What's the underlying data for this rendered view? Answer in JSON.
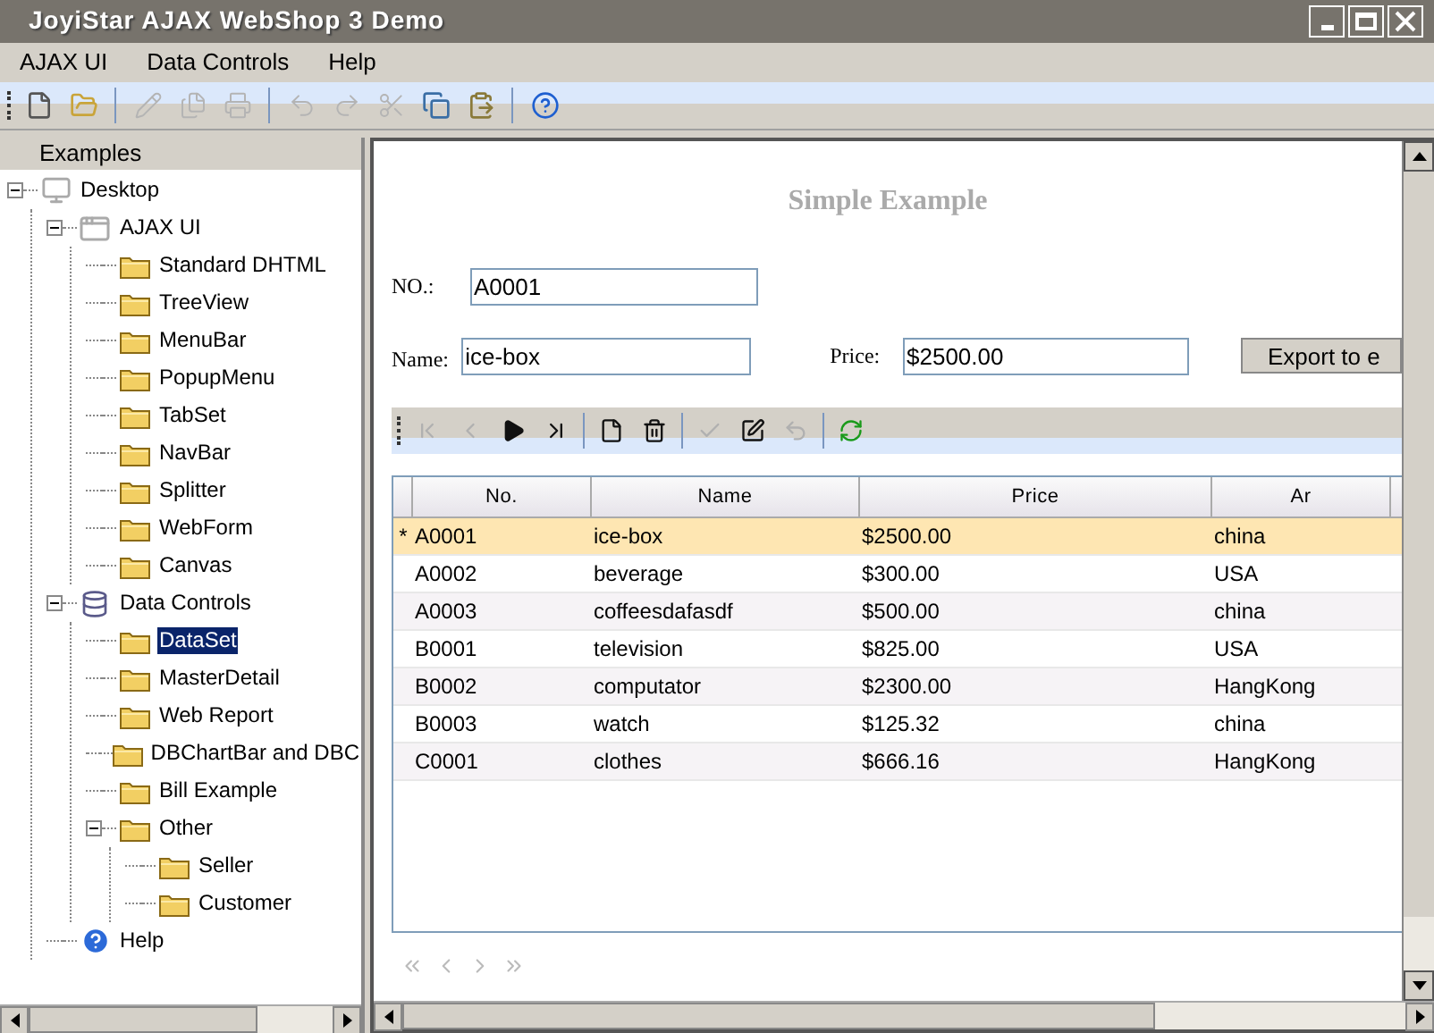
{
  "window": {
    "title": "JoyiStar AJAX WebShop 3 Demo"
  },
  "menu": [
    "AJAX UI",
    "Data Controls",
    "Help"
  ],
  "toolbar": [
    {
      "kind": "new",
      "disabled": false
    },
    {
      "kind": "open",
      "disabled": false
    },
    {
      "kind": "sep"
    },
    {
      "kind": "edit",
      "disabled": true
    },
    {
      "kind": "copy-doc",
      "disabled": true
    },
    {
      "kind": "print",
      "disabled": true
    },
    {
      "kind": "sep"
    },
    {
      "kind": "undo",
      "disabled": true
    },
    {
      "kind": "redo",
      "disabled": true
    },
    {
      "kind": "cut",
      "disabled": true
    },
    {
      "kind": "copy",
      "disabled": false
    },
    {
      "kind": "paste",
      "disabled": false
    },
    {
      "kind": "sep"
    },
    {
      "kind": "help",
      "disabled": false
    }
  ],
  "sidebar": {
    "title": "Examples",
    "tree": [
      {
        "label": "Desktop",
        "kind": "desktop",
        "expanded": true,
        "selected": false,
        "children": [
          {
            "label": "AJAX UI",
            "kind": "window",
            "expanded": true,
            "selected": false,
            "children": [
              {
                "label": "Standard DHTML",
                "kind": "folder",
                "selected": false
              },
              {
                "label": "TreeView",
                "kind": "folder",
                "selected": false
              },
              {
                "label": "MenuBar",
                "kind": "folder",
                "selected": false
              },
              {
                "label": "PopupMenu",
                "kind": "folder",
                "selected": false
              },
              {
                "label": "TabSet",
                "kind": "folder",
                "selected": false
              },
              {
                "label": "NavBar",
                "kind": "folder",
                "selected": false
              },
              {
                "label": "Splitter",
                "kind": "folder",
                "selected": false
              },
              {
                "label": "WebForm",
                "kind": "folder",
                "selected": false
              },
              {
                "label": "Canvas",
                "kind": "folder",
                "selected": false
              }
            ]
          },
          {
            "label": "Data Controls",
            "kind": "dataset",
            "expanded": true,
            "selected": false,
            "children": [
              {
                "label": "DataSet",
                "kind": "folder",
                "selected": true
              },
              {
                "label": "MasterDetail",
                "kind": "folder",
                "selected": false
              },
              {
                "label": "Web Report",
                "kind": "folder",
                "selected": false
              },
              {
                "label": "DBChartBar and DBC",
                "kind": "folder",
                "selected": false
              },
              {
                "label": "Bill Example",
                "kind": "folder",
                "selected": false
              },
              {
                "label": "Other",
                "kind": "folder",
                "expanded": true,
                "selected": false,
                "children": [
                  {
                    "label": "Seller",
                    "kind": "folder",
                    "selected": false
                  },
                  {
                    "label": "Customer",
                    "kind": "folder",
                    "selected": false
                  }
                ]
              }
            ]
          },
          {
            "label": "Help",
            "kind": "help",
            "selected": false
          }
        ]
      }
    ]
  },
  "form": {
    "title": "Simple Example",
    "no": {
      "label": "NO.:",
      "value": "A0001"
    },
    "name": {
      "label": "Name:",
      "value": "ice-box"
    },
    "price": {
      "label": "Price:",
      "value": "$2500.00"
    },
    "export_button": "Export to e"
  },
  "grid_toolbar": [
    {
      "kind": "first",
      "disabled": true
    },
    {
      "kind": "prev",
      "disabled": true
    },
    {
      "kind": "next",
      "disabled": false
    },
    {
      "kind": "last",
      "disabled": false
    },
    {
      "kind": "sep"
    },
    {
      "kind": "new",
      "disabled": false
    },
    {
      "kind": "delete",
      "disabled": false
    },
    {
      "kind": "sep"
    },
    {
      "kind": "post",
      "disabled": true
    },
    {
      "kind": "edit",
      "disabled": false
    },
    {
      "kind": "cancel",
      "disabled": true
    },
    {
      "kind": "sep"
    },
    {
      "kind": "refresh",
      "disabled": false
    }
  ],
  "table": {
    "columns": [
      "No.",
      "Name",
      "Price",
      "Ar"
    ],
    "rows": [
      {
        "selected": true,
        "marker": "*",
        "cells": [
          "A0001",
          "ice-box",
          "$2500.00",
          "china"
        ]
      },
      {
        "selected": false,
        "cells": [
          "A0002",
          "beverage",
          "$300.00",
          "USA"
        ]
      },
      {
        "selected": false,
        "cells": [
          "A0003",
          "coffeesdafasdf",
          "$500.00",
          "china"
        ]
      },
      {
        "selected": false,
        "cells": [
          "B0001",
          "television",
          "$825.00",
          "USA"
        ]
      },
      {
        "selected": false,
        "cells": [
          "B0002",
          "computator",
          "$2300.00",
          "HangKong"
        ]
      },
      {
        "selected": false,
        "cells": [
          "B0003",
          "watch",
          "$125.32",
          "china"
        ]
      },
      {
        "selected": false,
        "cells": [
          "C0001",
          "clothes",
          "$666.16",
          "HangKong"
        ]
      }
    ]
  },
  "pager": [
    {
      "kind": "first",
      "disabled": true
    },
    {
      "kind": "prev",
      "disabled": true
    },
    {
      "kind": "next",
      "disabled": true
    },
    {
      "kind": "last",
      "disabled": true
    }
  ]
}
